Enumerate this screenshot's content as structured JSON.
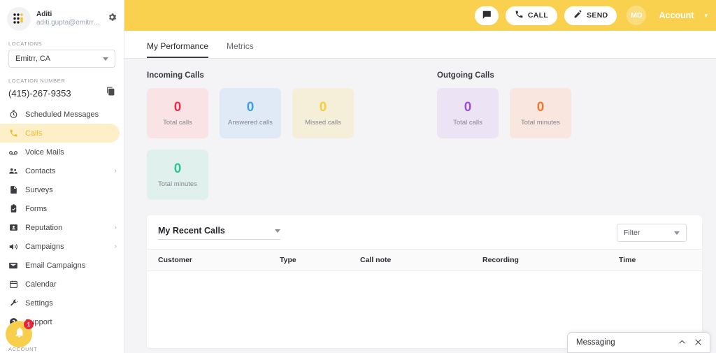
{
  "sidebar": {
    "profile": {
      "name": "Aditi",
      "email": "aditi.gupta@emitrr.c...",
      "gear_icon": "gear-icon",
      "logo_icon": "emitrr-logo-icon"
    },
    "locations_label": "LOCATIONS",
    "location_value": "Emitrr, CA",
    "location_number_label": "LOCATION NUMBER",
    "location_number": "(415)-267-9353",
    "copy_icon": "copy-icon",
    "items": [
      {
        "label": "Scheduled Messages",
        "icon": "clock-icon",
        "chevron": "",
        "active": false
      },
      {
        "label": "Calls",
        "icon": "phone-icon",
        "chevron": "",
        "active": true
      },
      {
        "label": "Voice Mails",
        "icon": "voicemail-icon",
        "chevron": "",
        "active": false
      },
      {
        "label": "Contacts",
        "icon": "people-icon",
        "chevron": "›",
        "active": false
      },
      {
        "label": "Surveys",
        "icon": "document-icon",
        "chevron": "",
        "active": false
      },
      {
        "label": "Forms",
        "icon": "clipboard-icon",
        "chevron": "",
        "active": false
      },
      {
        "label": "Reputation",
        "icon": "badge-icon",
        "chevron": "›",
        "active": false
      },
      {
        "label": "Campaigns",
        "icon": "megaphone-icon",
        "chevron": "›",
        "active": false
      },
      {
        "label": "Email Campaigns",
        "icon": "envelope-icon",
        "chevron": "",
        "active": false
      },
      {
        "label": "Calendar",
        "icon": "calendar-icon",
        "chevron": "",
        "active": false
      },
      {
        "label": "Settings",
        "icon": "wrench-icon",
        "chevron": "",
        "active": false
      },
      {
        "label": "Support",
        "icon": "help-icon",
        "chevron": "",
        "active": false
      }
    ],
    "notification_count": "1",
    "bell_icon": "bell-icon",
    "account_footer_label": "ACCOUNT"
  },
  "topbar": {
    "background": "#f9d14e",
    "message_icon": "message-icon",
    "call_label": "CALL",
    "call_icon": "phone-icon",
    "send_label": "SEND",
    "send_icon": "pencil-icon",
    "avatar_initials": "MD",
    "account_label": "Account",
    "account_caret_icon": "chevron-down-icon"
  },
  "tabs": [
    {
      "label": "My Performance",
      "active": true
    },
    {
      "label": "Metrics",
      "active": false
    }
  ],
  "stats": {
    "incoming_title": "Incoming Calls",
    "outgoing_title": "Outgoing Calls",
    "incoming": [
      {
        "value": "0",
        "label": "Total calls",
        "color": "#ef2b4d",
        "bg": "#f9e3e5"
      },
      {
        "value": "0",
        "label": "Answered calls",
        "color": "#3fa0e0",
        "bg": "#e0eaf6"
      },
      {
        "value": "0",
        "label": "Missed calls",
        "color": "#f5cd3d",
        "bg": "#f5efd9"
      }
    ],
    "incoming_row2": [
      {
        "value": "0",
        "label": "Total minutes",
        "color": "#2ec49a",
        "bg": "#e0f0ec"
      }
    ],
    "outgoing": [
      {
        "value": "0",
        "label": "Total calls",
        "color": "#9b4fd2",
        "bg": "#ece3f5"
      },
      {
        "value": "0",
        "label": "Total minutes",
        "color": "#f4772e",
        "bg": "#f9e6de"
      }
    ]
  },
  "table": {
    "select_label": "My Recent Calls",
    "select_caret_icon": "chevron-down-icon",
    "filter_label": "Filter",
    "filter_caret_icon": "chevron-down-icon",
    "columns": [
      "Customer",
      "Type",
      "Call note",
      "Recording",
      "Time"
    ],
    "rows": []
  },
  "messaging": {
    "title": "Messaging",
    "collapse_icon": "chevron-up-icon",
    "close_icon": "close-icon"
  }
}
